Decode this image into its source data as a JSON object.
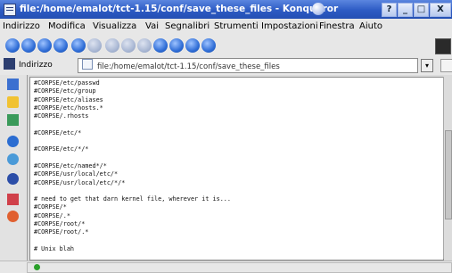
{
  "window": {
    "title": "file:/home/emalot/tct-1.15/conf/save_these_files - Konqueror"
  },
  "titlebar_buttons": [
    "?",
    "_",
    "□",
    "X"
  ],
  "menu": [
    "Indirizzo",
    "Modifica",
    "Visualizza",
    "Vai",
    "Segnalibri",
    "Strumenti",
    "Impostazioni",
    "Finestra",
    "Aiuto"
  ],
  "toolbar": {
    "icons": [
      "back-icon",
      "forward-icon",
      "up-icon",
      "home-icon",
      "reload-icon",
      "stop-icon",
      "cut-icon",
      "copy-icon",
      "paste-icon",
      "print-icon",
      "zoom-in-icon",
      "zoom-out-icon",
      "find-icon"
    ]
  },
  "location": {
    "label": "Indirizzo",
    "url": "file:/home/emalot/tct-1.15/conf/save_these_files"
  },
  "file_content": "#CORPSE/etc/passwd\n#CORPSE/etc/group\n#CORPSE/etc/aliases\n#CORPSE/etc/hosts.*\n#CORPSE/.rhosts\n\n#CORPSE/etc/*\n\n#CORPSE/etc/*/*\n\n#CORPSE/etc/named*/*\n#CORPSE/usr/local/etc/*\n#CORPSE/usr/local/etc/*/*\n\n# need to get that darn kernel file, wherever it is...\n#CORPSE/*\n#CORPSE/.*\n#CORPSE/root/*\n#CORPSE/root/.*\n\n# Unix blah",
  "colors": {
    "title_bar": "#2d5bc4",
    "desktop": "#1f4aa8"
  }
}
